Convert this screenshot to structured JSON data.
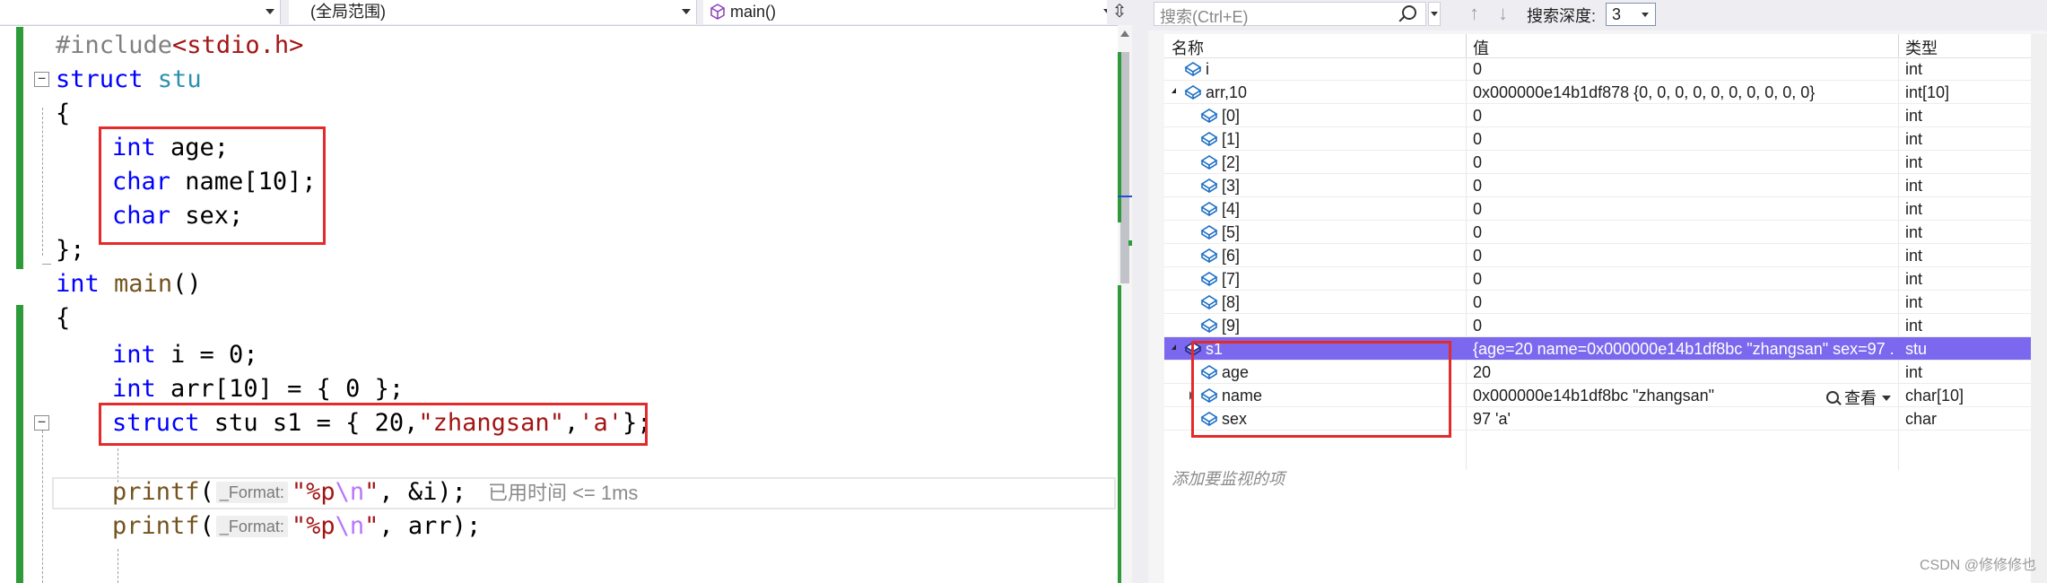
{
  "editor": {
    "nav": {
      "project_combo": "",
      "scope_combo": "(全局范围)",
      "member_combo": "main()",
      "split_button": "⇳"
    },
    "lines": [
      [
        "#include",
        "<stdio.h>"
      ],
      [
        "struct",
        " stu"
      ],
      [
        "{"
      ],
      [
        "int",
        " age;"
      ],
      [
        "char",
        " name[10];"
      ],
      [
        "char",
        " sex;"
      ],
      [
        "};"
      ],
      [
        "int",
        " ",
        "main",
        "()"
      ],
      [
        "{"
      ],
      [
        "int",
        " i = 0;"
      ],
      [
        "int",
        " arr[10] = { 0 };"
      ],
      [
        "struct",
        " stu s1 = { 20,",
        "\"zhangsan\"",
        ",",
        "'a'",
        "};"
      ],
      [
        "printf",
        "(",
        "_Format:",
        "\"%p",
        "\\n",
        "\"",
        ", &i);",
        "已用时间 <= 1ms"
      ],
      [
        "printf",
        "(",
        "_Format:",
        "\"%p",
        "\\n",
        "\"",
        ", arr);"
      ]
    ]
  },
  "watch": {
    "search_placeholder": "搜索(Ctrl+E)",
    "depth_label": "搜索深度:",
    "depth_value": "3",
    "columns": {
      "name": "名称",
      "value": "值",
      "type": "类型"
    },
    "rows": [
      {
        "name": "i",
        "value": "0",
        "type": "int",
        "level": 0,
        "expander": "none"
      },
      {
        "name": "arr,10",
        "value": "0x000000e14b1df878 {0, 0, 0, 0, 0, 0, 0, 0, 0, 0}",
        "type": "int[10]",
        "level": 0,
        "expander": "open"
      },
      {
        "name": "[0]",
        "value": "0",
        "type": "int",
        "level": 1,
        "expander": "none"
      },
      {
        "name": "[1]",
        "value": "0",
        "type": "int",
        "level": 1,
        "expander": "none"
      },
      {
        "name": "[2]",
        "value": "0",
        "type": "int",
        "level": 1,
        "expander": "none"
      },
      {
        "name": "[3]",
        "value": "0",
        "type": "int",
        "level": 1,
        "expander": "none"
      },
      {
        "name": "[4]",
        "value": "0",
        "type": "int",
        "level": 1,
        "expander": "none"
      },
      {
        "name": "[5]",
        "value": "0",
        "type": "int",
        "level": 1,
        "expander": "none"
      },
      {
        "name": "[6]",
        "value": "0",
        "type": "int",
        "level": 1,
        "expander": "none"
      },
      {
        "name": "[7]",
        "value": "0",
        "type": "int",
        "level": 1,
        "expander": "none"
      },
      {
        "name": "[8]",
        "value": "0",
        "type": "int",
        "level": 1,
        "expander": "none"
      },
      {
        "name": "[9]",
        "value": "0",
        "type": "int",
        "level": 1,
        "expander": "none"
      },
      {
        "name": "s1",
        "value": "{age=20 name=0x000000e14b1df8bc \"zhangsan\" sex=97 ...",
        "type": "stu",
        "level": 0,
        "expander": "open",
        "selected": true
      },
      {
        "name": "age",
        "value": "20",
        "type": "int",
        "level": 1,
        "expander": "none"
      },
      {
        "name": "name",
        "value": "0x000000e14b1df8bc \"zhangsan\"",
        "type": "char[10]",
        "level": 1,
        "expander": "closed",
        "peek": "查看"
      },
      {
        "name": "sex",
        "value": "97 'a'",
        "type": "char",
        "level": 1,
        "expander": "none"
      }
    ],
    "add_watch_placeholder": "添加要监视的项"
  },
  "watermark": "CSDN @修修修也",
  "colors": {
    "keyword": "#0000ff",
    "string": "#a31515",
    "escape": "#b776fb",
    "function": "#74531f",
    "preprocessor": "#808080",
    "change_bar": "#2e9b3a",
    "selection": "#7b68ee",
    "annotation_box": "#e32b2b"
  }
}
